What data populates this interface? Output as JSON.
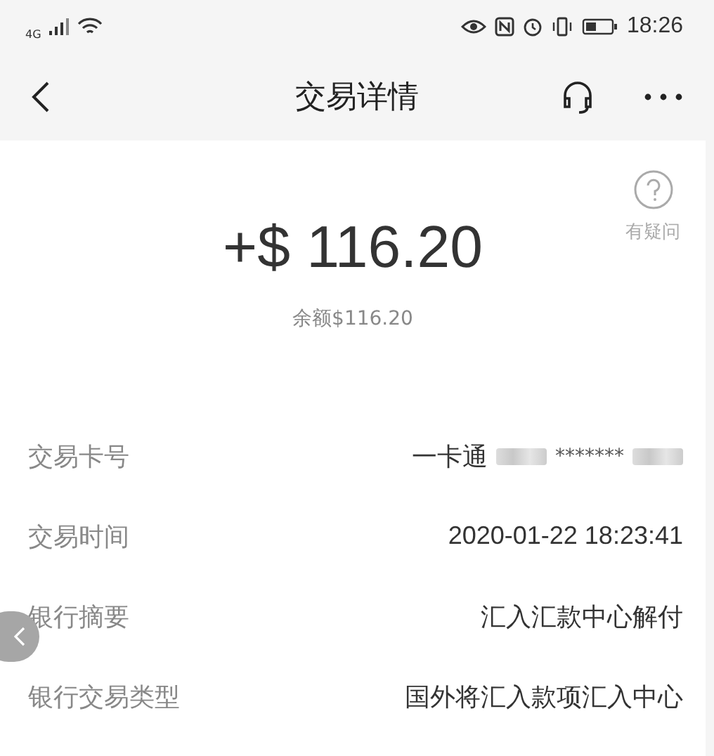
{
  "status_bar": {
    "network": "4G",
    "time": "18:26"
  },
  "nav": {
    "title": "交易详情"
  },
  "help": {
    "label": "有疑问"
  },
  "amount": "+$ 116.20",
  "balance": "余额$116.20",
  "rows": [
    {
      "label": "交易卡号",
      "value": "一卡通",
      "masked": "*******"
    },
    {
      "label": "交易时间",
      "value": "2020-01-22 18:23:41"
    },
    {
      "label": "银行摘要",
      "value": "汇入汇款中心解付"
    },
    {
      "label": "银行交易类型",
      "value": "国外将汇入款项汇入中心"
    }
  ]
}
